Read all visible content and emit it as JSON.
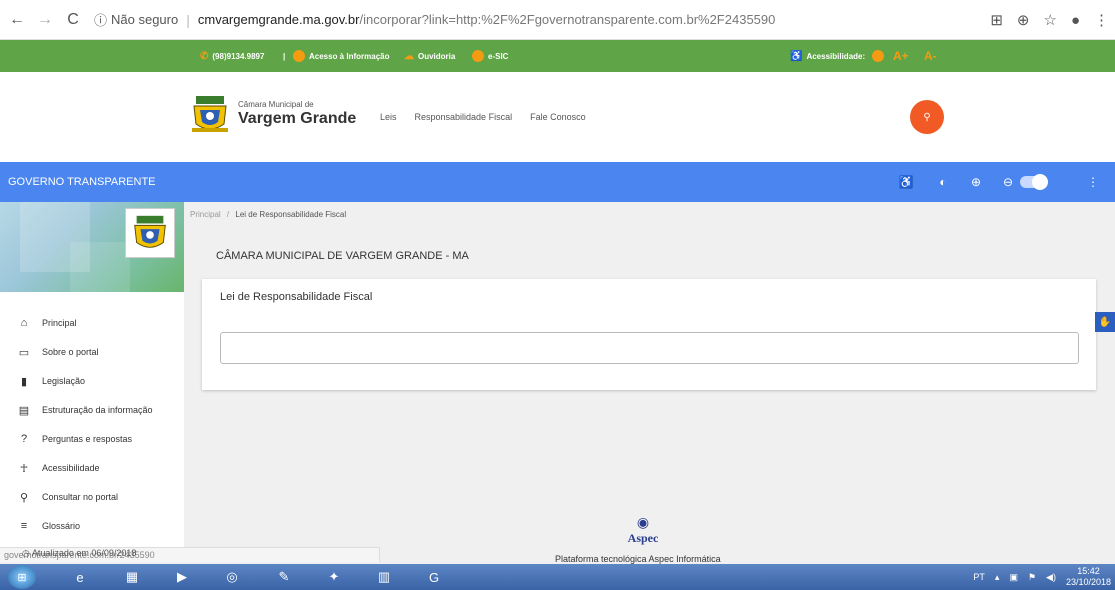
{
  "browser": {
    "insecure_label": "Não seguro",
    "url_host": "cmvargemgrande.ma.gov.br",
    "url_path": "/incorporar?link=http:%2F%2Fgovernotransparente.com.br%2F2435590"
  },
  "topbar": {
    "phone": "(98)9134.9897",
    "links": [
      "Acesso à Informação",
      "Ouvidoria",
      "e-SIC"
    ],
    "accessibility_label": "Acessibilidade:",
    "font_increase": "A+",
    "font_decrease": "A-"
  },
  "header": {
    "brand_small": "Câmara Municipal de",
    "brand_big": "Vargem Grande",
    "nav": [
      "Leis",
      "Responsabilidade Fiscal",
      "Fale Conosco"
    ]
  },
  "bluebar": {
    "title": "GOVERNO TRANSPARENTE"
  },
  "sidebar": {
    "items": [
      {
        "label": "Principal",
        "icon": "home-icon"
      },
      {
        "label": "Sobre o portal",
        "icon": "folder-icon"
      },
      {
        "label": "Legislação",
        "icon": "document-icon"
      },
      {
        "label": "Estruturação da informação",
        "icon": "structure-icon"
      },
      {
        "label": "Perguntas e respostas",
        "icon": "question-icon"
      },
      {
        "label": "Acessibilidade",
        "icon": "accessibility-icon"
      },
      {
        "label": "Consultar no portal",
        "icon": "search-icon"
      },
      {
        "label": "Glossário",
        "icon": "list-icon"
      }
    ],
    "updated": "Atualizado em 06/09/2018"
  },
  "main": {
    "breadcrumb_root": "Principal",
    "breadcrumb_sep": "/",
    "breadcrumb_current": "Lei de Responsabilidade Fiscal",
    "org_title": "CÂMARA MUNICIPAL DE VARGEM GRANDE - MA",
    "card_title": "Lei de Responsabilidade Fiscal"
  },
  "footer": {
    "logo_word": "Aspec",
    "platform_text": "Plataforma tecnológica Aspec Informática"
  },
  "statusbar": {
    "text": "governotransparente.com.br/2435590"
  },
  "taskbar": {
    "lang": "PT",
    "time": "15:42",
    "date": "23/10/2018"
  },
  "colors": {
    "green": "#5fa447",
    "blue": "#4a85f0",
    "orange": "#f15a24"
  }
}
